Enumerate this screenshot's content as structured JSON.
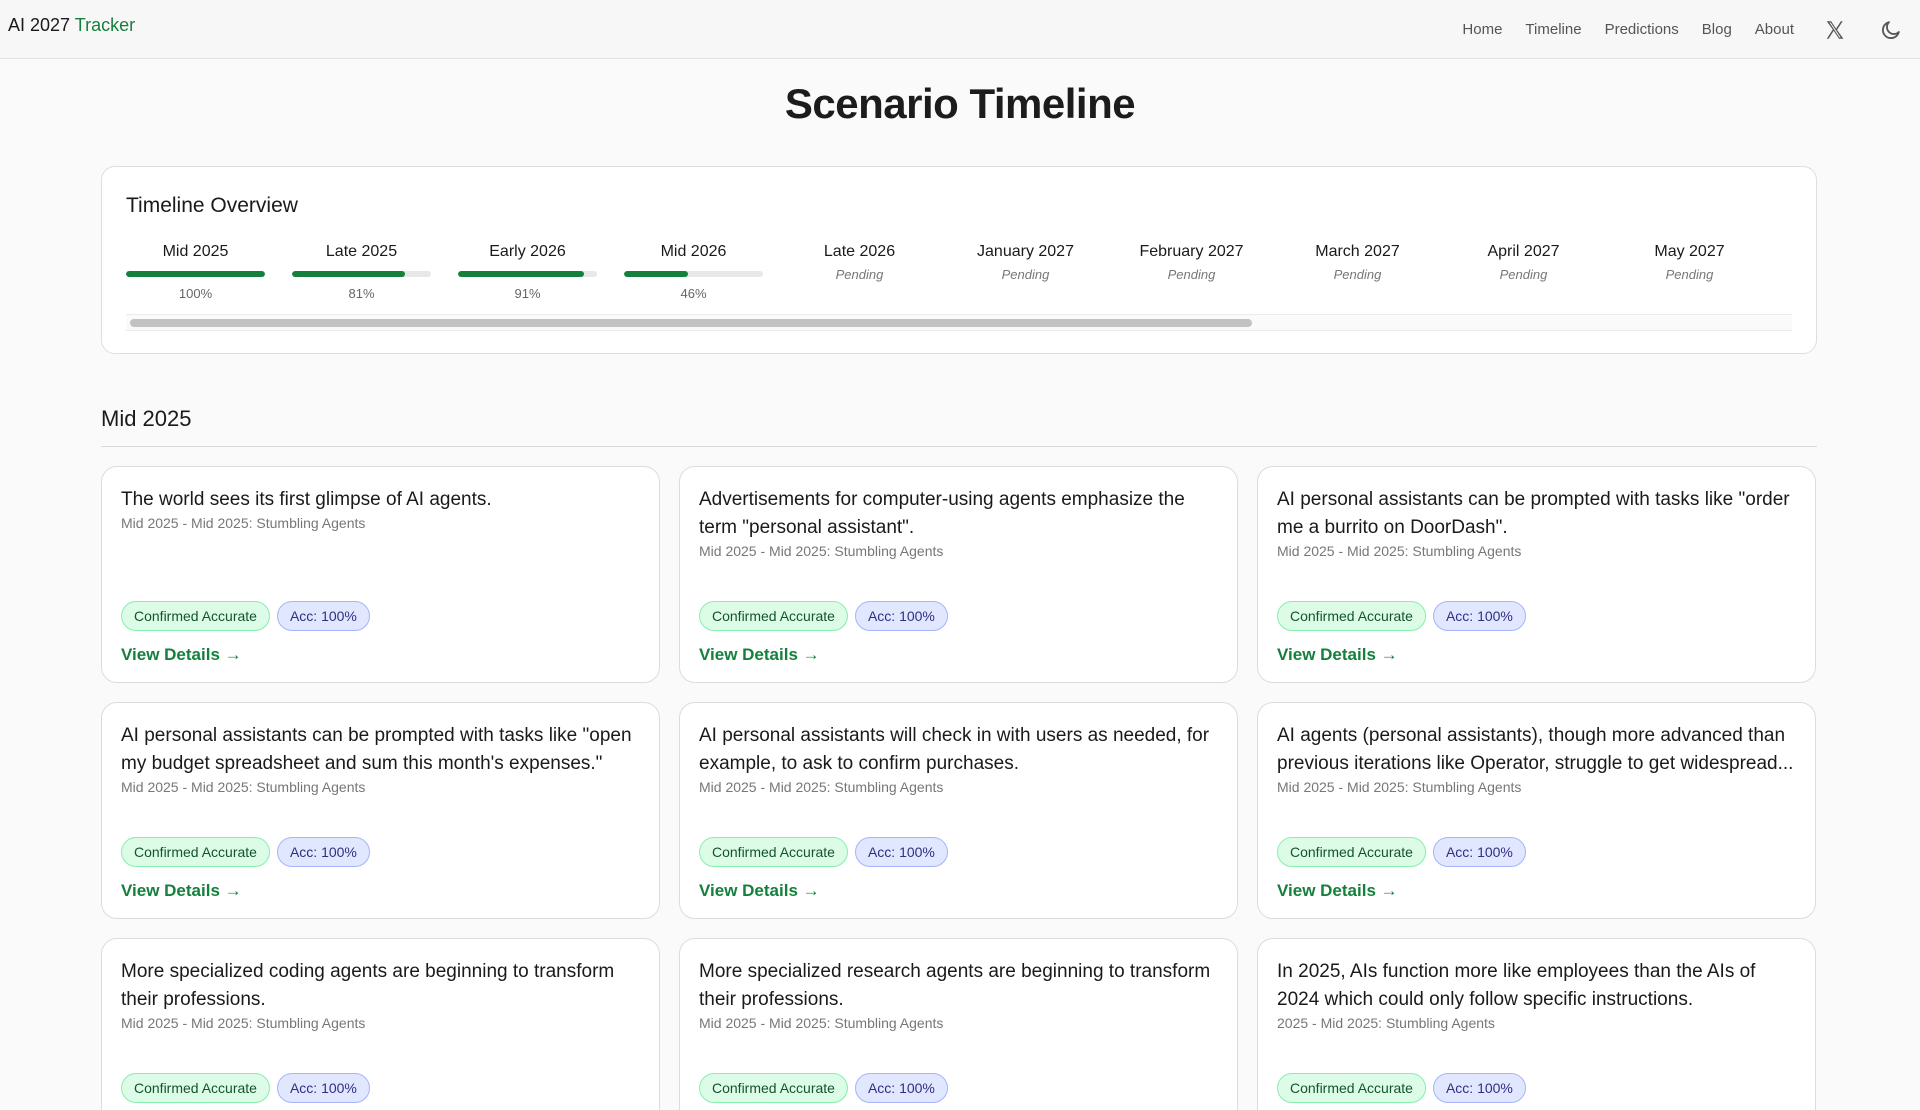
{
  "header": {
    "brand_prefix": "AI 2027",
    "brand_accent": "Tracker",
    "nav": [
      "Home",
      "Timeline",
      "Predictions",
      "Blog",
      "About"
    ],
    "icons": [
      "x-logo-icon",
      "moon-icon"
    ]
  },
  "page_title": "Scenario Timeline",
  "overview": {
    "title": "Timeline Overview",
    "items": [
      {
        "label": "Mid 2025",
        "status": "100%",
        "progress": 1.0
      },
      {
        "label": "Late 2025",
        "status": "81%",
        "progress": 0.81
      },
      {
        "label": "Early 2026",
        "status": "91%",
        "progress": 0.91
      },
      {
        "label": "Mid 2026",
        "status": "46%",
        "progress": 0.46
      },
      {
        "label": "Late 2026",
        "status": "Pending",
        "progress": null
      },
      {
        "label": "January 2027",
        "status": "Pending",
        "progress": null
      },
      {
        "label": "February 2027",
        "status": "Pending",
        "progress": null
      },
      {
        "label": "March 2027",
        "status": "Pending",
        "progress": null
      },
      {
        "label": "April 2027",
        "status": "Pending",
        "progress": null
      },
      {
        "label": "May 2027",
        "status": "Pending",
        "progress": null
      }
    ]
  },
  "section": {
    "title": "Mid 2025",
    "cards": [
      {
        "title": "The world sees its first glimpse of AI agents.",
        "meta": "Mid 2025 - Mid 2025: Stumbling Agents",
        "badge_status": "Confirmed Accurate",
        "badge_acc": "Acc: 100%",
        "link": "View Details →"
      },
      {
        "title": "Advertisements for computer-using agents emphasize the term \"personal assistant\".",
        "meta": "Mid 2025 - Mid 2025: Stumbling Agents",
        "badge_status": "Confirmed Accurate",
        "badge_acc": "Acc: 100%",
        "link": "View Details →"
      },
      {
        "title": "AI personal assistants can be prompted with tasks like \"order me a burrito on DoorDash\".",
        "meta": "Mid 2025 - Mid 2025: Stumbling Agents",
        "badge_status": "Confirmed Accurate",
        "badge_acc": "Acc: 100%",
        "link": "View Details →"
      },
      {
        "title": "AI personal assistants can be prompted with tasks like \"open my budget spreadsheet and sum this month's expenses.\"",
        "meta": "Mid 2025 - Mid 2025: Stumbling Agents",
        "badge_status": "Confirmed Accurate",
        "badge_acc": "Acc: 100%",
        "link": "View Details →"
      },
      {
        "title": "AI personal assistants will check in with users as needed, for example, to ask to confirm purchases.",
        "meta": "Mid 2025 - Mid 2025: Stumbling Agents",
        "badge_status": "Confirmed Accurate",
        "badge_acc": "Acc: 100%",
        "link": "View Details →"
      },
      {
        "title": "AI agents (personal assistants), though more advanced than previous iterations like Operator, struggle to get widespread...",
        "meta": "Mid 2025 - Mid 2025: Stumbling Agents",
        "badge_status": "Confirmed Accurate",
        "badge_acc": "Acc: 100%",
        "link": "View Details →"
      },
      {
        "title": "More specialized coding agents are beginning to transform their professions.",
        "meta": "Mid 2025 - Mid 2025: Stumbling Agents",
        "badge_status": "Confirmed Accurate",
        "badge_acc": "Acc: 100%",
        "link": "View Details →"
      },
      {
        "title": "More specialized research agents are beginning to transform their professions.",
        "meta": "Mid 2025 - Mid 2025: Stumbling Agents",
        "badge_status": "Confirmed Accurate",
        "badge_acc": "Acc: 100%",
        "link": "View Details →"
      },
      {
        "title": "In 2025, AIs function more like employees than the AIs of 2024 which could only follow specific instructions.",
        "meta": "2025 - Mid 2025: Stumbling Agents",
        "badge_status": "Confirmed Accurate",
        "badge_acc": "Acc: 100%",
        "link": "View Details →"
      }
    ]
  }
}
